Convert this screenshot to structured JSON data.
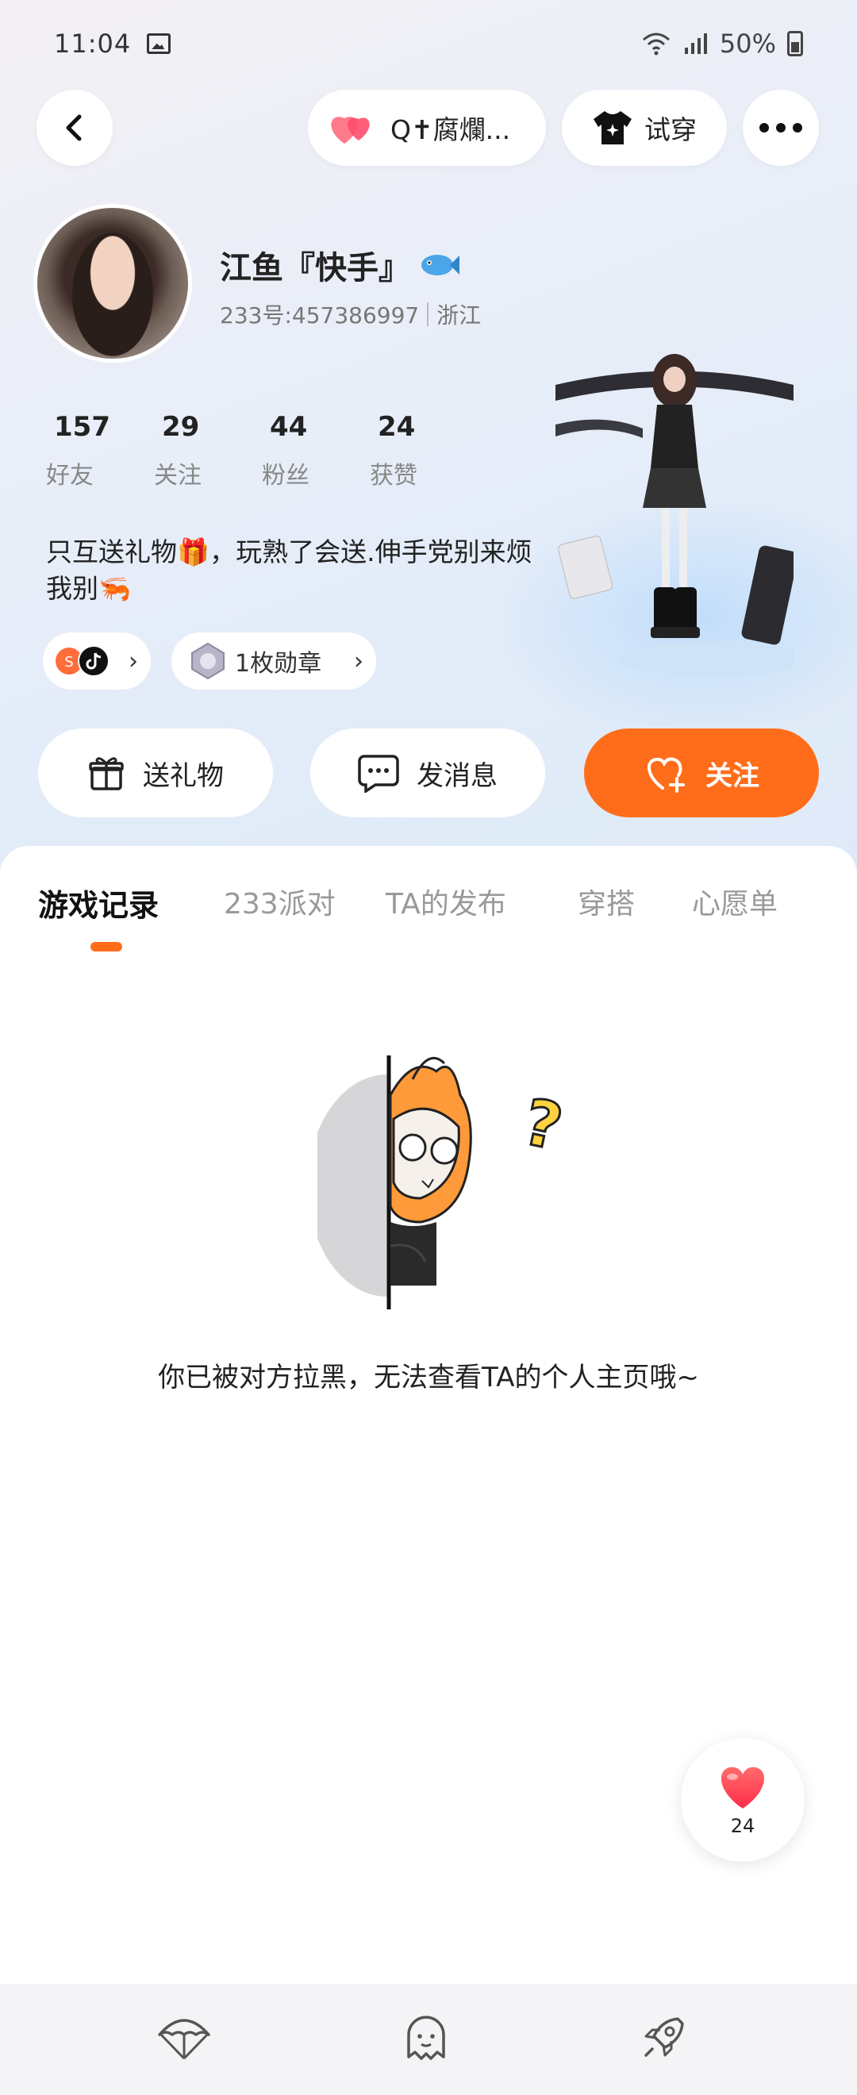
{
  "status_bar": {
    "time": "11:04",
    "battery": "50%",
    "icons": [
      "gallery-icon",
      "wifi-icon",
      "signal-icon",
      "battery-icon"
    ]
  },
  "header": {
    "cp_label": "Q✝腐爛...",
    "try_on_label": "试穿",
    "icons": [
      "back-icon",
      "heart-icon",
      "shirt-icon",
      "more-icon"
    ]
  },
  "profile": {
    "name": "江鱼『快手』",
    "id_label": "233号:457386997",
    "region": "浙江",
    "stats": [
      {
        "value": "157",
        "label": "好友"
      },
      {
        "value": "29",
        "label": "关注"
      },
      {
        "value": "44",
        "label": "粉丝"
      },
      {
        "value": "24",
        "label": "获赞"
      }
    ],
    "bio_line1": "只互送礼物🎁，玩熟了会送.伸手党别来烦",
    "bio_line2": "我别🦐",
    "medal_label": "1枚勋章"
  },
  "actions": {
    "gift_label": "送礼物",
    "message_label": "发消息",
    "follow_label": "关注"
  },
  "tabs": [
    {
      "label": "游戏记录",
      "active": true
    },
    {
      "label": "233派对",
      "active": false
    },
    {
      "label": "TA的发布",
      "active": false
    },
    {
      "label": "穿搭",
      "active": false
    },
    {
      "label": "心愿单",
      "active": false
    }
  ],
  "empty_state": {
    "message": "你已被对方拉黑，无法查看TA的个人主页哦~"
  },
  "like_float": {
    "count": "24"
  },
  "colors": {
    "accent": "#ff6d1a",
    "like_red": "#ff3b4a",
    "hero_bg": "#e6eefa"
  }
}
